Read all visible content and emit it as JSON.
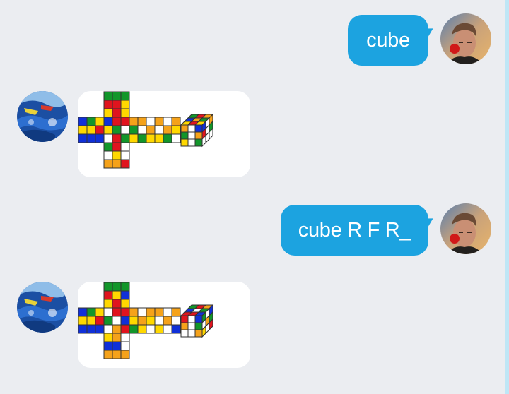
{
  "messages": [
    {
      "direction": "outgoing",
      "text": "cube",
      "avatar": "user-avatar"
    },
    {
      "direction": "incoming",
      "image": "rubiks-cube-net",
      "avatar": "bot-avatar",
      "net": {
        "up": [
          [
            "G",
            "G",
            "G"
          ],
          [
            "R",
            "R",
            "Y"
          ],
          [
            "Y",
            "R",
            "Y"
          ]
        ],
        "left": [
          [
            "B",
            "G",
            "Y"
          ],
          [
            "Y",
            "Y",
            "R"
          ],
          [
            "B",
            "B",
            "B"
          ]
        ],
        "front": [
          [
            "B",
            "R",
            "R"
          ],
          [
            "Y",
            "G",
            "W"
          ],
          [
            "W",
            "R",
            "G"
          ]
        ],
        "right": [
          [
            "O",
            "O",
            "W"
          ],
          [
            "G",
            "W",
            "O"
          ],
          [
            "Y",
            "G",
            "Y"
          ]
        ],
        "back": [
          [
            "O",
            "W",
            "O"
          ],
          [
            "W",
            "O",
            "Y"
          ],
          [
            "Y",
            "G",
            "W"
          ]
        ],
        "down": [
          [
            "G",
            "R",
            "W"
          ],
          [
            "W",
            "Y",
            "W"
          ],
          [
            "O",
            "O",
            "R"
          ]
        ],
        "iso_top": [
          [
            "G",
            "R",
            "O"
          ],
          [
            "B",
            "O",
            "G"
          ],
          [
            "Y",
            "R",
            "Y"
          ]
        ],
        "iso_front": [
          [
            "O",
            "W",
            "B"
          ],
          [
            "G",
            "W",
            "O"
          ],
          [
            "Y",
            "W",
            "G"
          ]
        ],
        "iso_side": [
          [
            "B",
            "W",
            "O"
          ],
          [
            "R",
            "W",
            "G"
          ],
          [
            "W",
            "W",
            "W"
          ]
        ]
      }
    },
    {
      "direction": "outgoing",
      "text": "cube R F R_",
      "avatar": "user-avatar"
    },
    {
      "direction": "incoming",
      "image": "rubiks-cube-net",
      "avatar": "bot-avatar",
      "net": {
        "up": [
          [
            "G",
            "G",
            "G"
          ],
          [
            "R",
            "Y",
            "B"
          ],
          [
            "Y",
            "R",
            "Y"
          ]
        ],
        "left": [
          [
            "B",
            "G",
            "Y"
          ],
          [
            "Y",
            "Y",
            "R"
          ],
          [
            "B",
            "B",
            "B"
          ]
        ],
        "front": [
          [
            "W",
            "R",
            "R"
          ],
          [
            "G",
            "W",
            "B"
          ],
          [
            "W",
            "O",
            "R"
          ]
        ],
        "right": [
          [
            "O",
            "W",
            "O"
          ],
          [
            "Y",
            "O",
            "Y"
          ],
          [
            "G",
            "Y",
            "W"
          ]
        ],
        "back": [
          [
            "O",
            "W",
            "O"
          ],
          [
            "W",
            "O",
            "W"
          ],
          [
            "Y",
            "W",
            "B"
          ]
        ],
        "down": [
          [
            "Y",
            "O",
            "W"
          ],
          [
            "B",
            "B",
            "W"
          ],
          [
            "O",
            "O",
            "O"
          ]
        ],
        "iso_top": [
          [
            "G",
            "R",
            "O"
          ],
          [
            "B",
            "W",
            "G"
          ],
          [
            "R",
            "R",
            "B"
          ]
        ],
        "iso_front": [
          [
            "R",
            "W",
            "B"
          ],
          [
            "O",
            "W",
            "G"
          ],
          [
            "W",
            "W",
            "O"
          ]
        ],
        "iso_side": [
          [
            "G",
            "W",
            "B"
          ],
          [
            "W",
            "O",
            "G"
          ],
          [
            "Y",
            "W",
            "R"
          ]
        ]
      }
    }
  ],
  "colors": {
    "W": "#ffffff",
    "Y": "#ffd800",
    "R": "#e0141e",
    "O": "#f5a21a",
    "G": "#12962a",
    "B": "#1030d8",
    "bubble_out": "#1ca3e0",
    "background": "#ebedf1"
  }
}
